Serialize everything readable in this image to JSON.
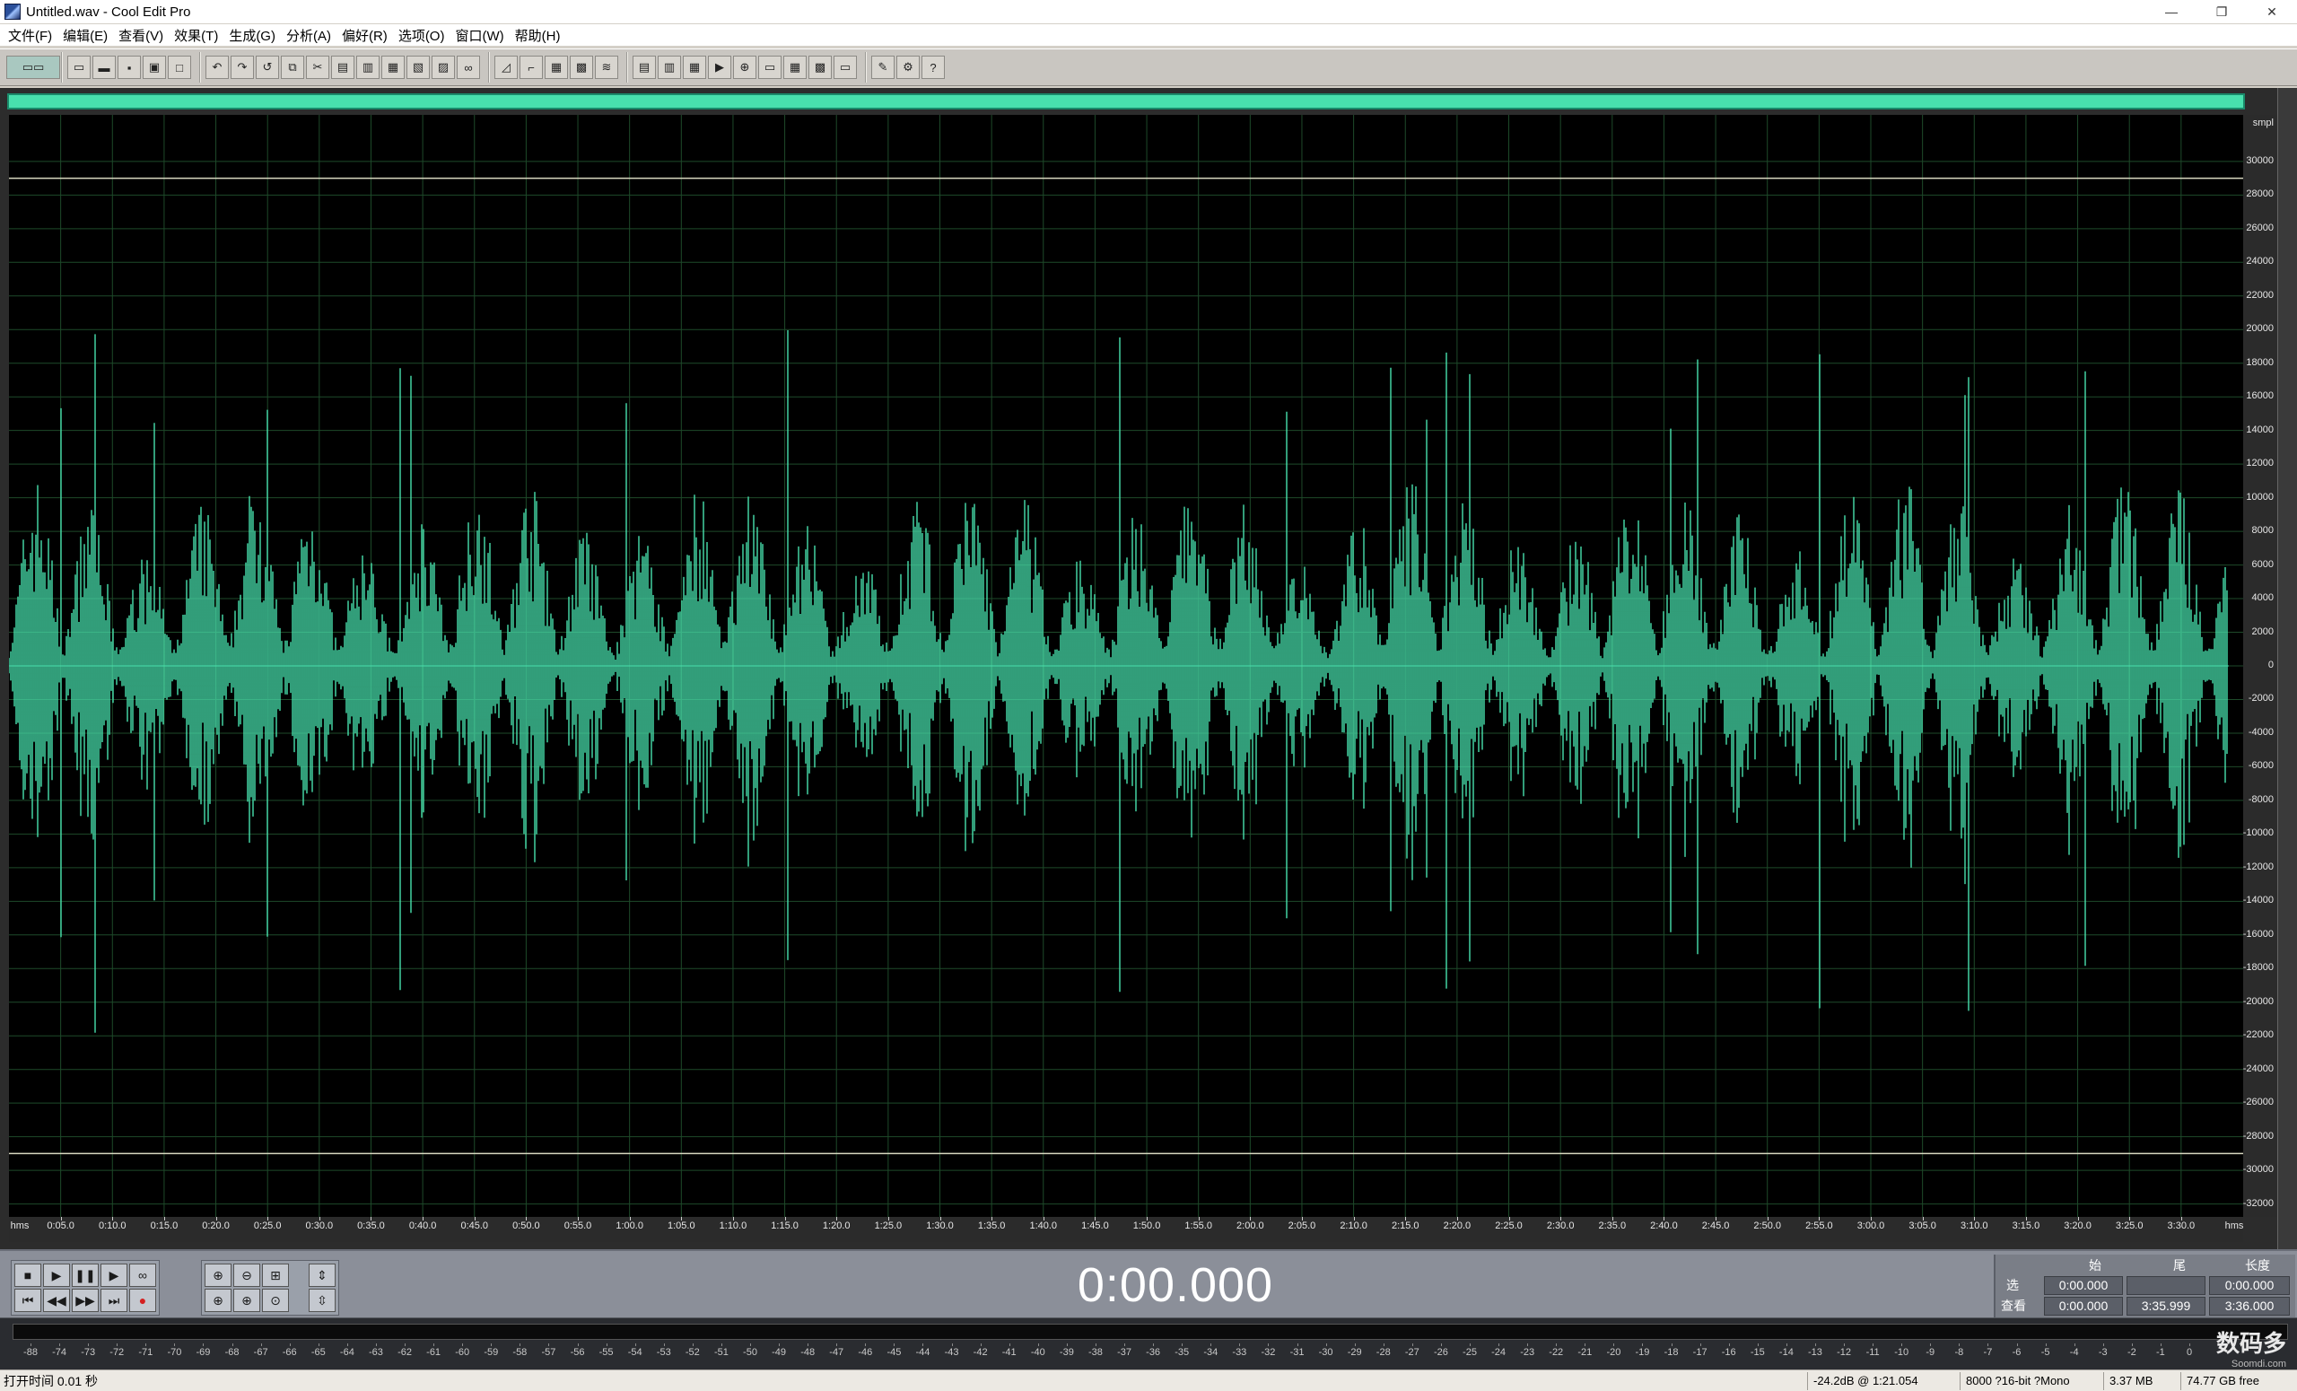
{
  "window": {
    "title": "Untitled.wav - Cool Edit Pro",
    "controls": {
      "minimize": "—",
      "maximize": "❐",
      "close": "✕"
    }
  },
  "menu": [
    "文件(F)",
    "编辑(E)",
    "查看(V)",
    "效果(T)",
    "生成(G)",
    "分析(A)",
    "偏好(R)",
    "选项(O)",
    "窗口(W)",
    "帮助(H)"
  ],
  "toolbar": {
    "mode_button": "multitrack-toggle-icon",
    "groups": [
      [
        "new-file-icon",
        "open-file-icon",
        "save-icon",
        "save-as-icon",
        "close-file-icon"
      ],
      [
        "undo-icon",
        "redo-icon",
        "repeat-icon",
        "copy-icon",
        "cut-icon",
        "paste-icon",
        "paste-new-icon",
        "mix-paste-icon",
        "trim-icon",
        "crop-icon",
        "loop-icon"
      ],
      [
        "envelope-icon",
        "stretch-icon",
        "multi-icon",
        "amplify-icon",
        "wave-icon"
      ],
      [
        "settings-icon",
        "dither-icon",
        "normalize-icon",
        "play-icon",
        "zoom-icon",
        "range-icon",
        "grid-icon",
        "spectral-icon",
        "blank-icon"
      ],
      [
        "script-icon",
        "batch-icon",
        "help-icon"
      ]
    ]
  },
  "waveform": {
    "color": "#48e0ad",
    "y_unit": "smpl",
    "y_ticks": [
      "30000",
      "28000",
      "26000",
      "24000",
      "22000",
      "20000",
      "18000",
      "16000",
      "14000",
      "12000",
      "10000",
      "8000",
      "6000",
      "4000",
      "2000",
      "0",
      "-2000",
      "-4000",
      "-6000",
      "-8000",
      "-10000",
      "-12000",
      "-14000",
      "-16000",
      "-18000",
      "-20000",
      "-22000",
      "-24000",
      "-26000",
      "-28000",
      "-30000",
      "-32000"
    ],
    "x_unit": "hms",
    "x_ticks": [
      "0:05.0",
      "0:10.0",
      "0:15.0",
      "0:20.0",
      "0:25.0",
      "0:30.0",
      "0:35.0",
      "0:40.0",
      "0:45.0",
      "0:50.0",
      "0:55.0",
      "1:00.0",
      "1:05.0",
      "1:10.0",
      "1:15.0",
      "1:20.0",
      "1:25.0",
      "1:30.0",
      "1:35.0",
      "1:40.0",
      "1:45.0",
      "1:50.0",
      "1:55.0",
      "2:00.0",
      "2:05.0",
      "2:10.0",
      "2:15.0",
      "2:20.0",
      "2:25.0",
      "2:30.0",
      "2:35.0",
      "2:40.0",
      "2:45.0",
      "2:50.0",
      "2:55.0",
      "3:00.0",
      "3:05.0",
      "3:10.0",
      "3:15.0",
      "3:20.0",
      "3:25.0",
      "3:30.0"
    ]
  },
  "transport": {
    "buttons": [
      "stop-icon",
      "play-icon",
      "pause-icon",
      "play-to-end-icon",
      "loop-icon",
      "go-start-icon",
      "rewind-icon",
      "fast-forward-icon",
      "go-end-icon",
      "record-icon"
    ],
    "zoom": [
      "zoom-in-icon",
      "zoom-out-icon",
      "zoom-full-icon",
      "zoom-in-vertical-icon",
      "zoom-left-icon",
      "zoom-right-icon",
      "zoom-selection-icon",
      "zoom-out-vertical-icon"
    ]
  },
  "time_display": "0:00.000",
  "selection": {
    "headers": {
      "begin": "始",
      "end": "尾",
      "length": "长度"
    },
    "rows": [
      {
        "label": "选",
        "begin": "0:00.000",
        "end": "",
        "length": "0:00.000"
      },
      {
        "label": "查看",
        "begin": "0:00.000",
        "end": "3:35.999",
        "length": "3:36.000"
      }
    ]
  },
  "meter": {
    "ticks": [
      "-88",
      "-74",
      "-73",
      "-72",
      "-71",
      "-70",
      "-69",
      "-68",
      "-67",
      "-66",
      "-65",
      "-64",
      "-63",
      "-62",
      "-61",
      "-60",
      "-59",
      "-58",
      "-57",
      "-56",
      "-55",
      "-54",
      "-53",
      "-52",
      "-51",
      "-50",
      "-49",
      "-48",
      "-47",
      "-46",
      "-45",
      "-44",
      "-43",
      "-42",
      "-41",
      "-40",
      "-39",
      "-38",
      "-37",
      "-36",
      "-35",
      "-34",
      "-33",
      "-32",
      "-31",
      "-30",
      "-29",
      "-28",
      "-27",
      "-26",
      "-25",
      "-24",
      "-23",
      "-22",
      "-21",
      "-20",
      "-19",
      "-18",
      "-17",
      "-16",
      "-15",
      "-14",
      "-13",
      "-12",
      "-11",
      "-10",
      "-9",
      "-8",
      "-7",
      "-6",
      "-5",
      "-4",
      "-3",
      "-2",
      "-1",
      "0"
    ],
    "watermark": "数码多",
    "watermark_url": "Soomdi.com"
  },
  "status": {
    "text": "打开时间 0.01 秒",
    "cells": [
      "-24.2dB @  1:21.054",
      "8000 ?16-bit ?Mono",
      "3.37 MB",
      "74.77 GB free"
    ]
  }
}
